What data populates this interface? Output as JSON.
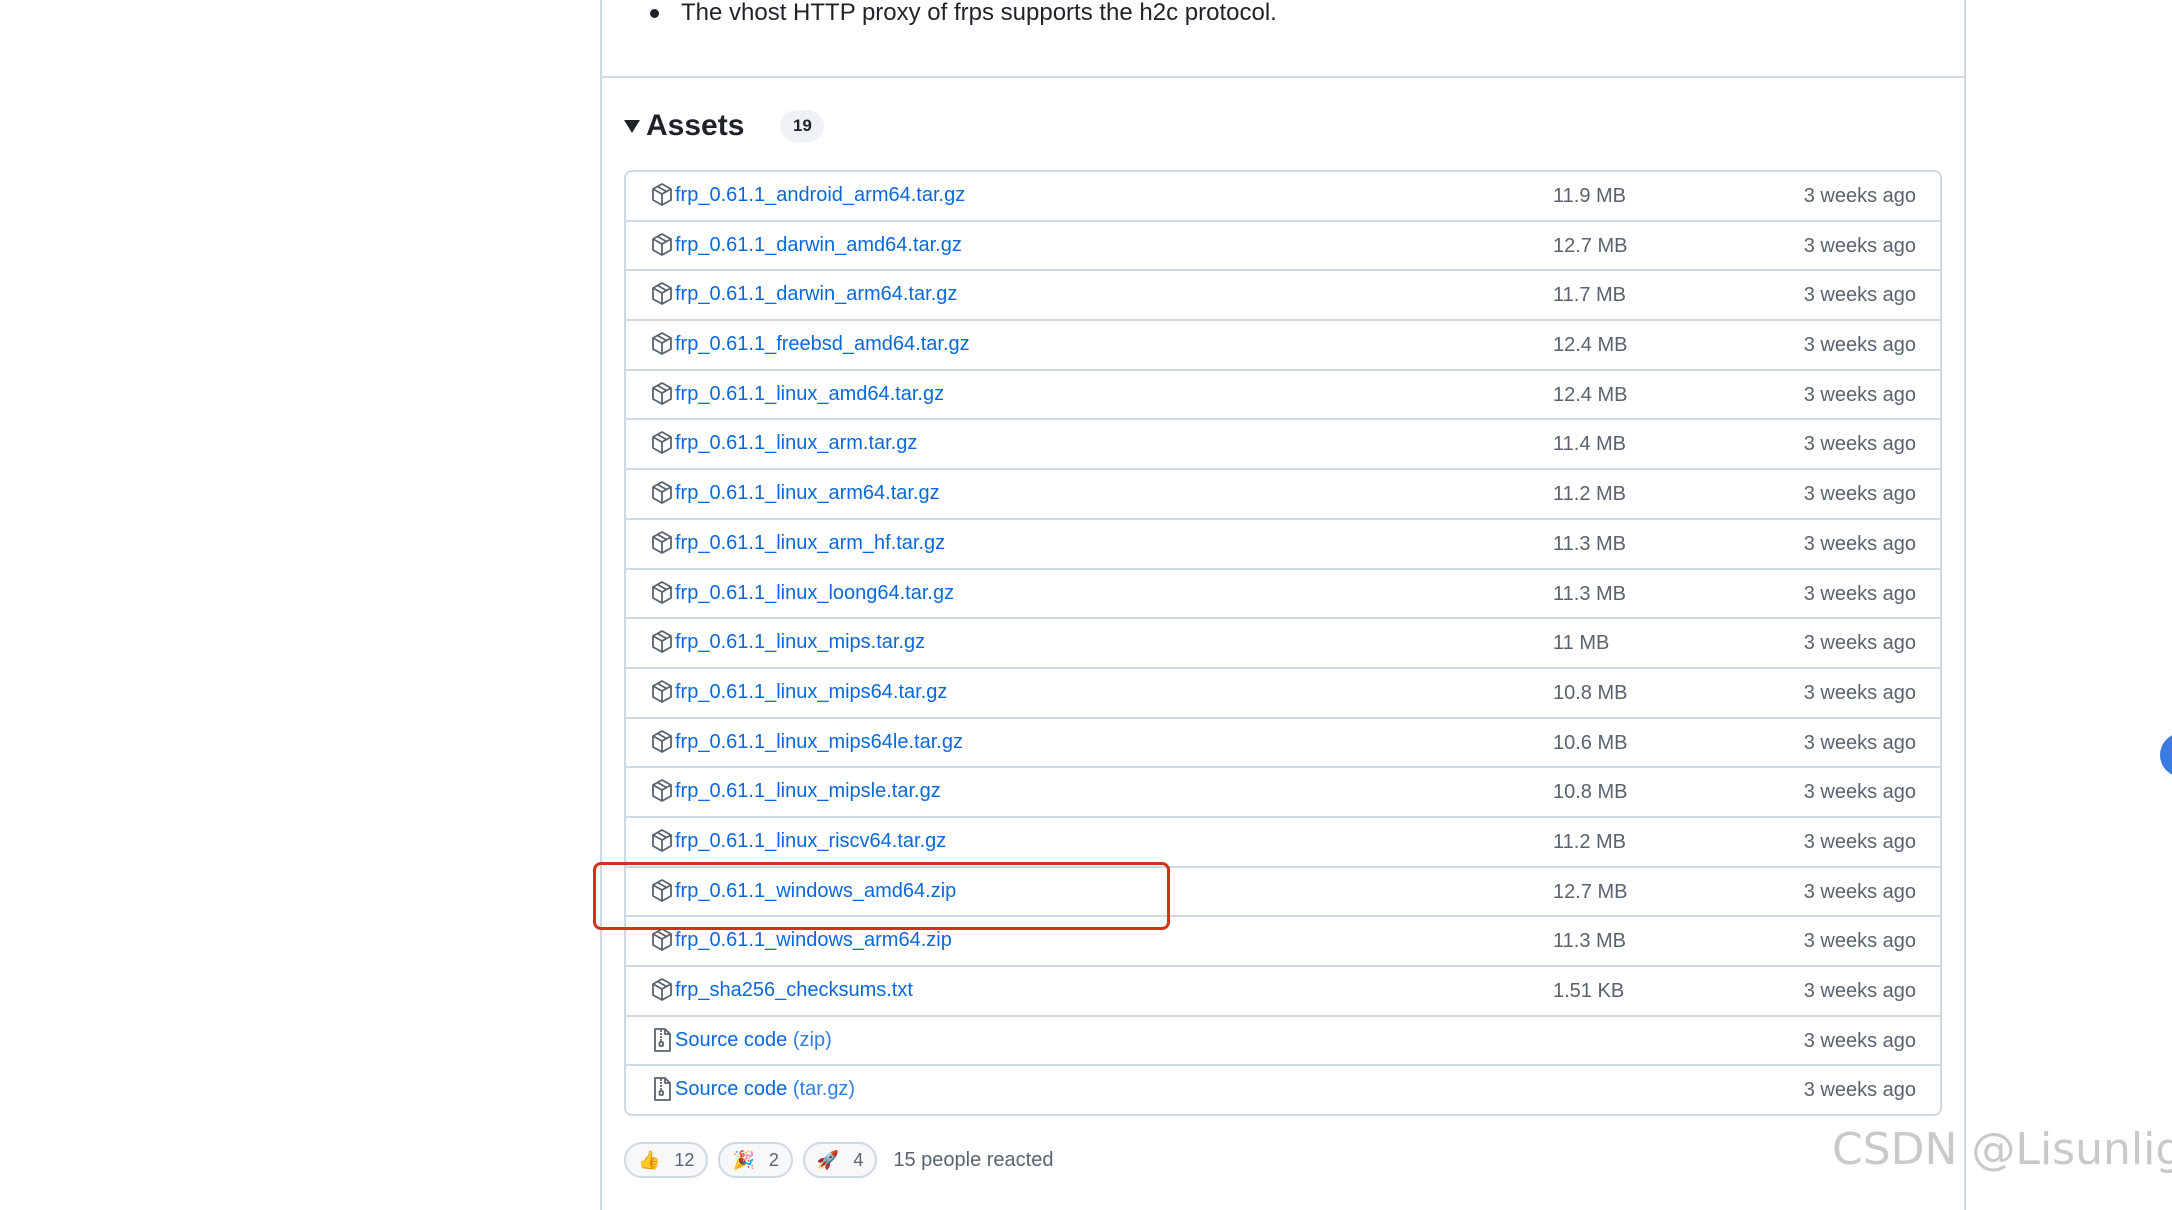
{
  "release_notes": {
    "last_bullet": "The vhost HTTP proxy of frps supports the h2c protocol."
  },
  "assets": {
    "title": "Assets",
    "count": "19",
    "items": [
      {
        "name": "frp_0.61.1_android_arm64.tar.gz",
        "size": "11.9 MB",
        "date": "3 weeks ago",
        "icon": "package-icon"
      },
      {
        "name": "frp_0.61.1_darwin_amd64.tar.gz",
        "size": "12.7 MB",
        "date": "3 weeks ago",
        "icon": "package-icon"
      },
      {
        "name": "frp_0.61.1_darwin_arm64.tar.gz",
        "size": "11.7 MB",
        "date": "3 weeks ago",
        "icon": "package-icon"
      },
      {
        "name": "frp_0.61.1_freebsd_amd64.tar.gz",
        "size": "12.4 MB",
        "date": "3 weeks ago",
        "icon": "package-icon"
      },
      {
        "name": "frp_0.61.1_linux_amd64.tar.gz",
        "size": "12.4 MB",
        "date": "3 weeks ago",
        "icon": "package-icon"
      },
      {
        "name": "frp_0.61.1_linux_arm.tar.gz",
        "size": "11.4 MB",
        "date": "3 weeks ago",
        "icon": "package-icon"
      },
      {
        "name": "frp_0.61.1_linux_arm64.tar.gz",
        "size": "11.2 MB",
        "date": "3 weeks ago",
        "icon": "package-icon"
      },
      {
        "name": "frp_0.61.1_linux_arm_hf.tar.gz",
        "size": "11.3 MB",
        "date": "3 weeks ago",
        "icon": "package-icon"
      },
      {
        "name": "frp_0.61.1_linux_loong64.tar.gz",
        "size": "11.3 MB",
        "date": "3 weeks ago",
        "icon": "package-icon"
      },
      {
        "name": "frp_0.61.1_linux_mips.tar.gz",
        "size": "11 MB",
        "date": "3 weeks ago",
        "icon": "package-icon"
      },
      {
        "name": "frp_0.61.1_linux_mips64.tar.gz",
        "size": "10.8 MB",
        "date": "3 weeks ago",
        "icon": "package-icon"
      },
      {
        "name": "frp_0.61.1_linux_mips64le.tar.gz",
        "size": "10.6 MB",
        "date": "3 weeks ago",
        "icon": "package-icon"
      },
      {
        "name": "frp_0.61.1_linux_mipsle.tar.gz",
        "size": "10.8 MB",
        "date": "3 weeks ago",
        "icon": "package-icon"
      },
      {
        "name": "frp_0.61.1_linux_riscv64.tar.gz",
        "size": "11.2 MB",
        "date": "3 weeks ago",
        "icon": "package-icon"
      },
      {
        "name": "frp_0.61.1_windows_amd64.zip",
        "size": "12.7 MB",
        "date": "3 weeks ago",
        "icon": "package-icon",
        "highlighted": true
      },
      {
        "name": "frp_0.61.1_windows_arm64.zip",
        "size": "11.3 MB",
        "date": "3 weeks ago",
        "icon": "package-icon"
      },
      {
        "name": "frp_sha256_checksums.txt",
        "size": "1.51 KB",
        "date": "3 weeks ago",
        "icon": "package-icon"
      },
      {
        "name": "Source code",
        "suffix": "(zip)",
        "size": "",
        "date": "3 weeks ago",
        "icon": "file-zip-icon"
      },
      {
        "name": "Source code",
        "suffix": "(tar.gz)",
        "size": "",
        "date": "3 weeks ago",
        "icon": "file-zip-icon"
      }
    ]
  },
  "reactions": {
    "items": [
      {
        "emoji": "👍",
        "count": "12",
        "icon": "thumbs-up-icon"
      },
      {
        "emoji": "🎉",
        "count": "2",
        "icon": "party-popper-icon"
      },
      {
        "emoji": "🚀",
        "count": "4",
        "icon": "rocket-icon"
      }
    ],
    "summary": "15 people reacted"
  },
  "watermark": "CSDN @Lisunlight",
  "colors": {
    "link": "#0969da",
    "muted": "#59636e",
    "border": "#d1d9e0",
    "highlight": "#d0321e"
  }
}
